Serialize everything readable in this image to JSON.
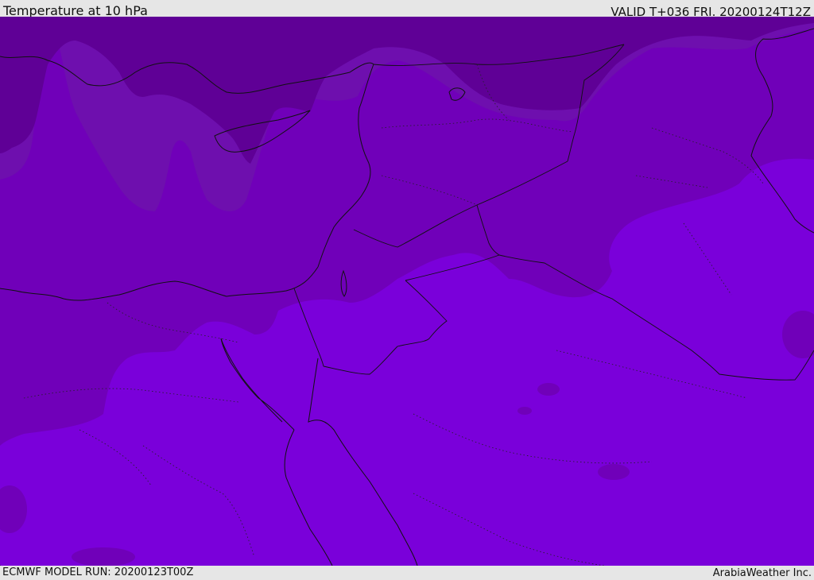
{
  "header": {
    "title": "Temperature at 10 hPa",
    "valid_time": "VALID T+036 FRI. 20200124T12Z"
  },
  "footer": {
    "model_run": "ECMWF MODEL RUN: 20200123T00Z",
    "credit": "ArabiaWeather Inc."
  },
  "map": {
    "colors": {
      "coldest_band": "#5f0096",
      "cold_band": "#6e0fae",
      "mid_band": "#7700c8",
      "warm_band": "#7a00da",
      "outline": "#111111"
    }
  }
}
